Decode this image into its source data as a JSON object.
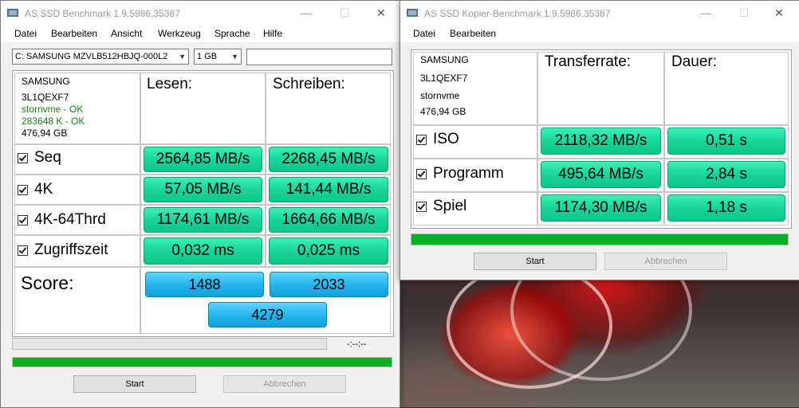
{
  "colors": {
    "value_green": "#18d59a",
    "score_blue": "#22b3ee",
    "progress_green": "#06b025",
    "ok_text": "#1a7a1a"
  },
  "bench": {
    "title": "AS SSD Benchmark 1.9.5986.35387",
    "menu": [
      "Datei",
      "Bearbeiten",
      "Ansicht",
      "Werkzeug",
      "Sprache",
      "Hilfe"
    ],
    "drive_select": "C: SAMSUNG MZVLB512HBJQ-000L2",
    "size_select": "1 GB",
    "device": {
      "name": "SAMSUNG",
      "serial": "3L1QEXF7",
      "driver": "stornvme - OK",
      "align": "283648 K - OK",
      "capacity": "476,94 GB"
    },
    "col_read": "Lesen:",
    "col_write": "Schreiben:",
    "rows": [
      {
        "label": "Seq",
        "read": "2564,85 MB/s",
        "write": "2268,45 MB/s"
      },
      {
        "label": "4K",
        "read": "57,05 MB/s",
        "write": "141,44 MB/s"
      },
      {
        "label": "4K-64Thrd",
        "read": "1174,61 MB/s",
        "write": "1664,66 MB/s"
      },
      {
        "label": "Zugriffszeit",
        "read": "0,032 ms",
        "write": "0,025 ms"
      }
    ],
    "score_label": "Score:",
    "score_read": "1488",
    "score_write": "2033",
    "score_total": "4279",
    "time": "-:--:--",
    "progress": 1.0,
    "start": "Start",
    "abort": "Abbrechen"
  },
  "copy": {
    "title": "AS SSD Kopier-Benchmark 1.9.5986.35387",
    "menu": [
      "Datei",
      "Bearbeiten"
    ],
    "device": {
      "name": "SAMSUNG",
      "serial": "3L1QEXF7",
      "driver": "stornvme",
      "capacity": "476,94 GB"
    },
    "col_rate": "Transferrate:",
    "col_time": "Dauer:",
    "rows": [
      {
        "label": "ISO",
        "rate": "2118,32 MB/s",
        "time": "0,51 s"
      },
      {
        "label": "Programm",
        "rate": "495,64 MB/s",
        "time": "2,84 s"
      },
      {
        "label": "Spiel",
        "rate": "1174,30 MB/s",
        "time": "1,18 s"
      }
    ],
    "progress": 1.0,
    "start": "Start",
    "abort": "Abbrechen"
  },
  "window_controls": {
    "minimize": "—",
    "maximize": "☐",
    "close": "✕"
  }
}
